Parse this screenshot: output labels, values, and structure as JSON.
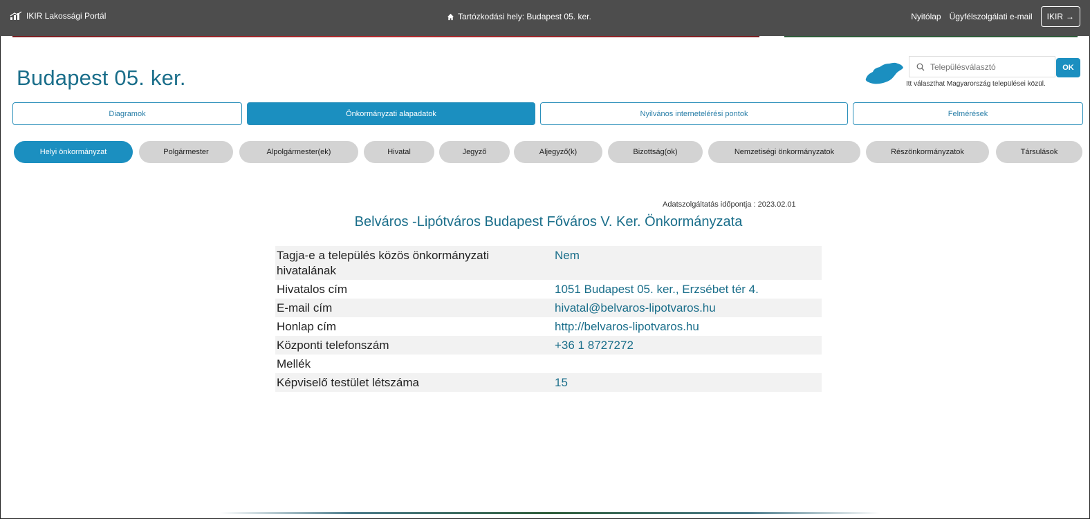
{
  "topbar": {
    "brand": "IKIR Lakossági Portál",
    "location": "Tartózkodási hely: Budapest 05. ker.",
    "links": [
      "Nyitólap",
      "Ügyfélszolgálati e-mail"
    ],
    "ikir_button": "IKIR",
    "ikir_arrow": "→"
  },
  "page": {
    "title": "Budapest 05. ker."
  },
  "search": {
    "placeholder": "Településválasztó",
    "ok": "OK",
    "hint": "Itt választhat Magyarország települései közül."
  },
  "main_tabs": [
    {
      "label": "Diagramok",
      "active": false
    },
    {
      "label": "Önkormányzati alapadatok",
      "active": true
    },
    {
      "label": "Nyilvános internetelérési pontok",
      "active": false
    },
    {
      "label": "Felmérések",
      "active": false
    }
  ],
  "sub_tabs": [
    {
      "label": "Helyi önkormányzat",
      "active": true
    },
    {
      "label": "Polgármester",
      "active": false
    },
    {
      "label": "Alpolgármester(ek)",
      "active": false
    },
    {
      "label": "Hivatal",
      "active": false
    },
    {
      "label": "Jegyző",
      "active": false
    },
    {
      "label": "Aljegyző(k)",
      "active": false
    },
    {
      "label": "Bizottság(ok)",
      "active": false
    },
    {
      "label": "Nemzetiségi önkormányzatok",
      "active": false
    },
    {
      "label": "Részönkormányzatok",
      "active": false
    },
    {
      "label": "Társulások",
      "active": false
    }
  ],
  "content": {
    "service_date": "Adatszolgáltatás időpontja : 2023.02.01",
    "org_title": "Belváros -Lipótváros Budapest Főváros V. Ker. Önkormányzata",
    "rows": [
      {
        "label": "Tagja-e a település közös önkormányzati hivatalának",
        "value": "Nem"
      },
      {
        "label": "Hivatalos cím",
        "value": "1051 Budapest 05. ker., Erzsébet tér 4."
      },
      {
        "label": "E-mail cím",
        "value": "hivatal@belvaros-lipotvaros.hu"
      },
      {
        "label": "Honlap cím",
        "value": "http://belvaros-lipotvaros.hu"
      },
      {
        "label": "Központi telefonszám",
        "value": "+36 1 8727272"
      },
      {
        "label": "Mellék",
        "value": ""
      },
      {
        "label": "Képviselő testület létszáma",
        "value": "15"
      }
    ]
  },
  "colors": {
    "topbar": "#4d4d4d",
    "accent": "#1b8fc0",
    "title": "#1a6e8a"
  },
  "icons": {
    "brand": "bar-chart-icon",
    "location": "home-icon",
    "search": "search-icon",
    "map": "hungary-map-icon"
  }
}
